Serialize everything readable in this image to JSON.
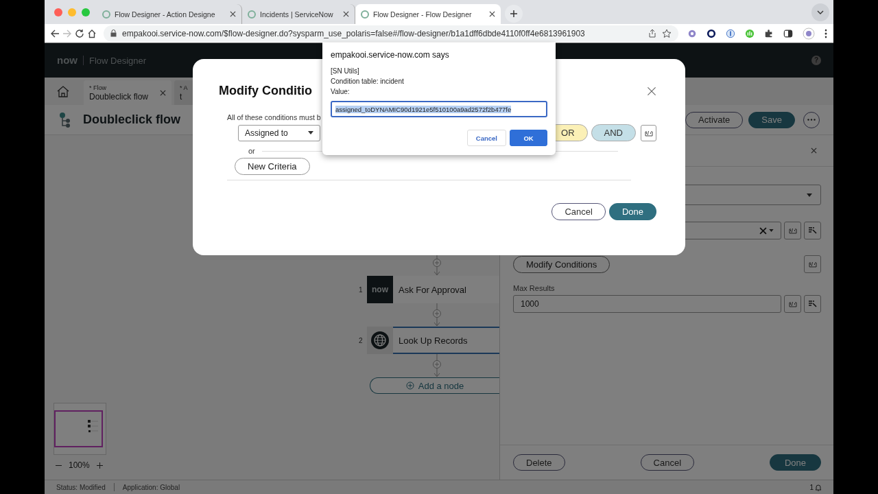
{
  "browser": {
    "tabs": [
      {
        "title": "Flow Designer - Action Designe",
        "selected": false
      },
      {
        "title": "Incidents | ServiceNow",
        "selected": false
      },
      {
        "title": "Flow Designer - Flow Designer",
        "selected": true
      }
    ],
    "nav": [
      {
        "kind": "back",
        "disabled": false
      },
      {
        "kind": "forward",
        "disabled": true
      },
      {
        "kind": "reload",
        "disabled": false
      },
      {
        "kind": "home",
        "disabled": false
      }
    ],
    "url": "empakooi.service-now.com/$flow-designer.do?sysparm_use_polaris=false#/flow-designer/b1a1dff6dbde4110f0ff4e6813961903"
  },
  "app_header": {
    "logo": "now",
    "title": "Flow Designer",
    "help": "?"
  },
  "doc_tabs": [
    {
      "mark": "*",
      "type": "Flow",
      "name": "Doubleclick flow",
      "selected": true
    },
    {
      "mark": "*",
      "type": "A",
      "name": "t",
      "selected": false
    }
  ],
  "flow": {
    "title": "Doubleclick flow",
    "actions": [
      {
        "label": "Activate",
        "kind": "outline"
      },
      {
        "label": "Save",
        "kind": "primary"
      }
    ]
  },
  "canvas": {
    "nodes": [
      {
        "number": "1",
        "kind": "core",
        "logo": "now",
        "label": "Ask For Approval",
        "selected": false
      },
      {
        "number": "2",
        "kind": "globe",
        "label": "Look Up Records",
        "selected": true
      }
    ],
    "add_node": "Add a node",
    "zoom": "100%"
  },
  "panel": {
    "modify_conditions": "Modify Conditions",
    "max_results_label": "Max Results",
    "max_results": "1000",
    "buttons": [
      {
        "label": "Delete",
        "kind": "outline"
      },
      {
        "label": "Cancel",
        "kind": "outline"
      },
      {
        "label": "Done",
        "kind": "primary"
      }
    ]
  },
  "status_bar": {
    "status": "Status: Modified",
    "application": "Application: Global",
    "notifications": "1"
  },
  "modal": {
    "title": "Modify Conditio",
    "instruction": "All of these conditions must b",
    "field": "Assigned to",
    "operators": [
      {
        "label": "OR",
        "color": "#fbf0b6"
      },
      {
        "label": "AND",
        "color": "#c4dfe7"
      }
    ],
    "or_label": "or",
    "new_criteria": "New Criteria",
    "buttons": [
      {
        "label": "Cancel",
        "kind": "outline"
      },
      {
        "label": "Done",
        "kind": "primary"
      }
    ]
  },
  "alert": {
    "title": "empakooi.service-now.com says",
    "lines": [
      "[SN Utils]",
      "Condition table: incident",
      "Value:"
    ],
    "value": "assigned_toDYNAMIC90d1921e5f510100a9ad2572f2b477fe",
    "value_selected": true,
    "cancel": "Cancel",
    "ok": "OK"
  }
}
